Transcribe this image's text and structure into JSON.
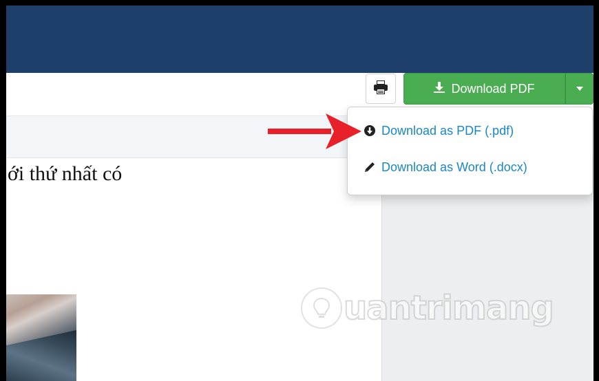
{
  "toolbar": {
    "print_icon": "print-icon",
    "download_button": {
      "label": "Download PDF",
      "icon": "download-icon",
      "color": "#4aad52"
    },
    "caret_icon": "caret-down-icon"
  },
  "dropdown": {
    "items": [
      {
        "label": "Download as PDF (.pdf)",
        "icon": "circle-arrow-down-icon"
      },
      {
        "label": "Download as Word (.docx)",
        "icon": "pencil-icon"
      }
    ],
    "text_color": "#1a86c8"
  },
  "document": {
    "visible_text": "ới thứ nhất có"
  },
  "watermark": {
    "text": "uantrimang"
  },
  "colors": {
    "navbar": "#1e3f6a",
    "annotation_arrow": "#e8202a"
  }
}
